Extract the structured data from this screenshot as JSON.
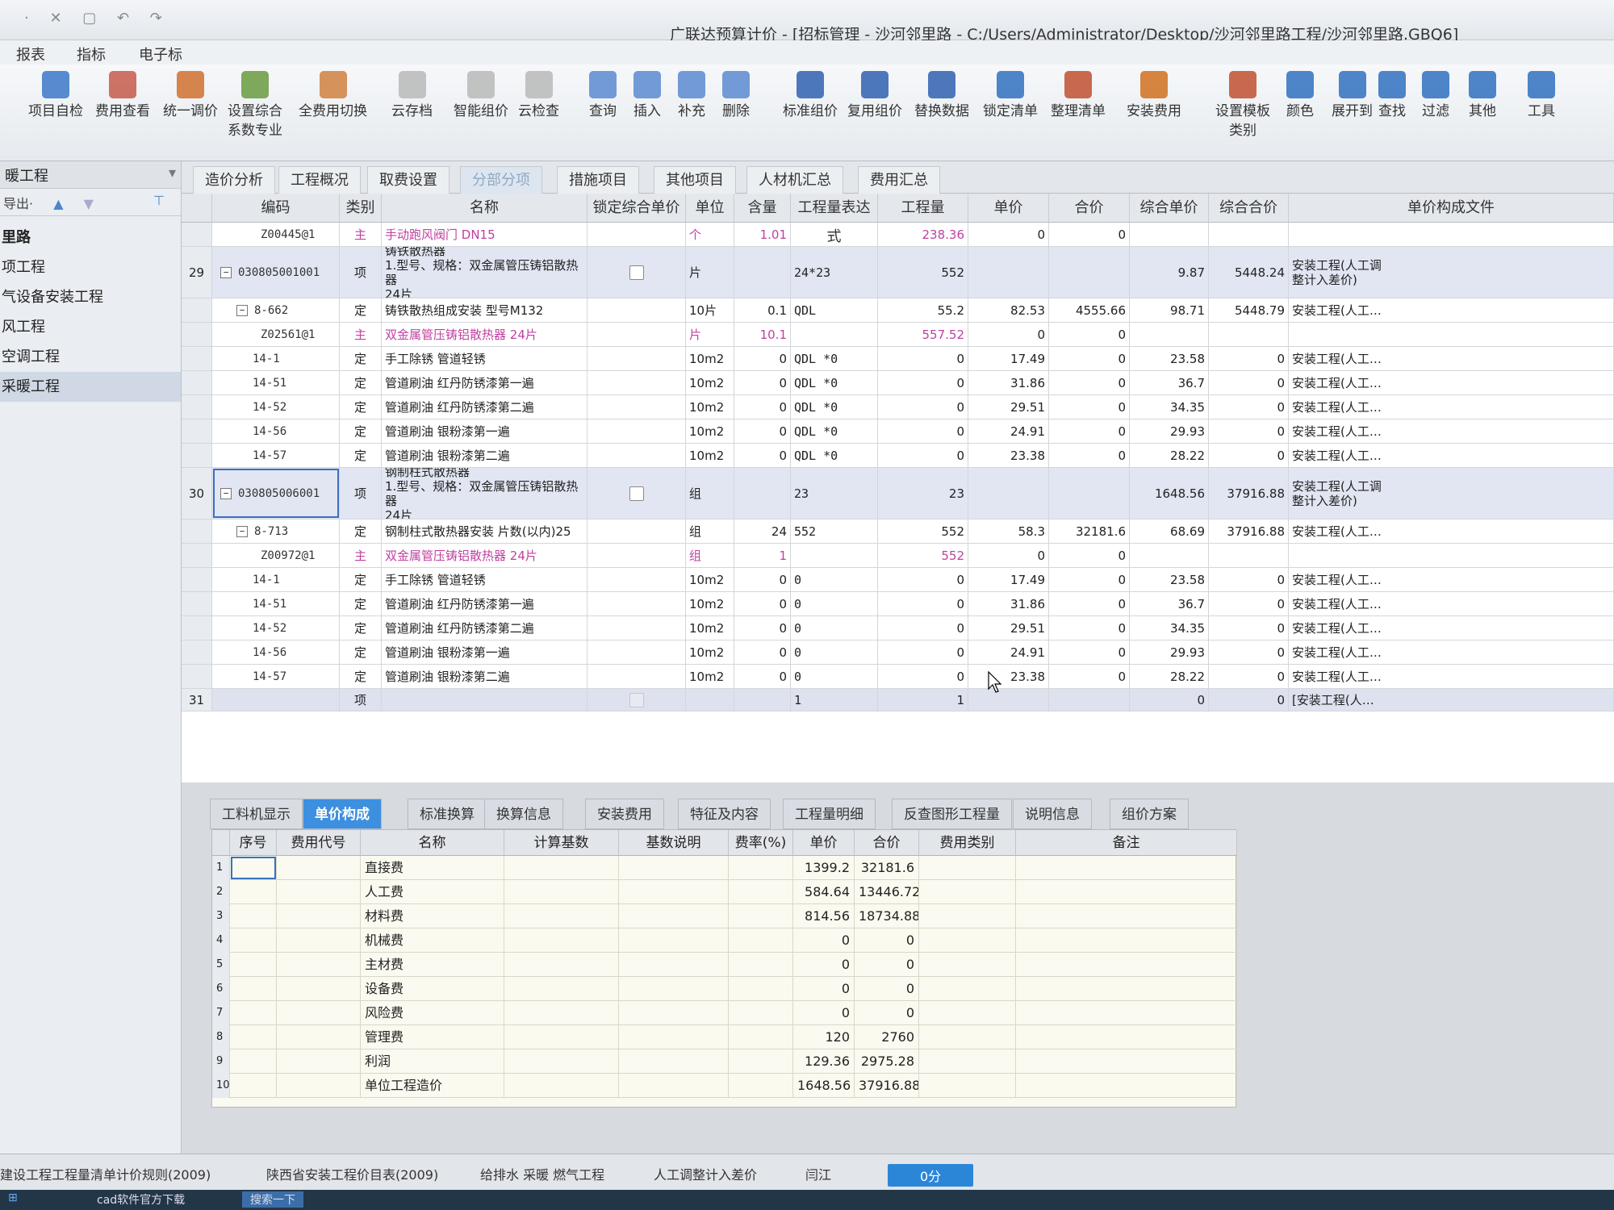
{
  "titlebar": {
    "quick_access": "· ✕ ▢ ↶ ↷",
    "title": "广联达预算计价 - [招标管理 - 沙河邻里路 - C:/Users/Administrator/Desktop/沙河邻里路工程/沙河邻里路.GBQ6]"
  },
  "menubar": [
    "报表",
    "指标",
    "电子标"
  ],
  "ribbon": [
    {
      "label": "项目自检",
      "icon": "check-icon",
      "color": "#3b78c8"
    },
    {
      "label": "费用查看",
      "icon": "view-cost-icon",
      "color": "#c65b4a"
    },
    {
      "label": "统一调价",
      "icon": "adjust-price-icon",
      "color": "#d07030"
    },
    {
      "label": "设置综合\n系数专业",
      "icon": "coefficient-icon",
      "color": "#6a9a40"
    },
    {
      "label": "全费用切换",
      "icon": "switch-icon",
      "color": "#d08040"
    },
    {
      "label": "云存档",
      "icon": "cloud-save-icon",
      "color": "#b8b8b8"
    },
    {
      "label": "智能组价",
      "icon": "smart-price-icon",
      "color": "#b8b8b8"
    },
    {
      "label": "云检查",
      "icon": "cloud-check-icon",
      "color": "#b8b8b8"
    },
    {
      "label": "查询",
      "icon": "query-icon",
      "color": "#5a8ad0"
    },
    {
      "label": "插入",
      "icon": "insert-icon",
      "color": "#5a8ad0"
    },
    {
      "label": "补充",
      "icon": "supplement-icon",
      "color": "#5a8ad0"
    },
    {
      "label": "删除",
      "icon": "delete-icon",
      "color": "#5a8ad0"
    },
    {
      "label": "标准组价",
      "icon": "standard-price-icon",
      "color": "#3060b0"
    },
    {
      "label": "复用组价",
      "icon": "reuse-price-icon",
      "color": "#3060b0"
    },
    {
      "label": "替换数据",
      "icon": "replace-data-icon",
      "color": "#3060b0"
    },
    {
      "label": "锁定清单",
      "icon": "lock-icon",
      "color": "#3070c0"
    },
    {
      "label": "整理清单",
      "icon": "organize-list-icon",
      "color": "#c05030"
    },
    {
      "label": "安装费用",
      "icon": "install-cost-icon",
      "color": "#d07020"
    },
    {
      "label": "设置模板\n类别",
      "icon": "template-icon",
      "color": "#c05030"
    },
    {
      "label": "颜色",
      "icon": "color-icon",
      "color": "#3070c0"
    },
    {
      "label": "展开到",
      "icon": "expand-icon",
      "color": "#3070c0"
    },
    {
      "label": "查找",
      "icon": "find-icon",
      "color": "#3070c0"
    },
    {
      "label": "过滤",
      "icon": "filter-icon",
      "color": "#3070c0"
    },
    {
      "label": "其他",
      "icon": "other-icon",
      "color": "#3070c0"
    },
    {
      "label": "工具",
      "icon": "tools-icon",
      "color": "#3070c0"
    }
  ],
  "left_panel": {
    "header": "暖工程",
    "toolbar": "导出·",
    "tree": [
      {
        "label": "里路",
        "bold": true,
        "selected": false
      },
      {
        "label": "项工程",
        "bold": false,
        "selected": false
      },
      {
        "label": "气设备安装工程",
        "bold": false,
        "selected": false
      },
      {
        "label": "风工程",
        "bold": false,
        "selected": false
      },
      {
        "label": "空调工程",
        "bold": false,
        "selected": false
      },
      {
        "label": "采暖工程",
        "bold": false,
        "selected": true
      }
    ]
  },
  "tabs": [
    {
      "label": "造价分析",
      "active": false
    },
    {
      "label": "工程概况",
      "active": false
    },
    {
      "label": "取费设置",
      "active": false
    },
    {
      "label": "分部分项",
      "active": true
    },
    {
      "label": "措施项目",
      "active": false
    },
    {
      "label": "其他项目",
      "active": false
    },
    {
      "label": "人材机汇总",
      "active": false
    },
    {
      "label": "费用汇总",
      "active": false
    }
  ],
  "grid": {
    "columns": [
      "编码",
      "类别",
      "名称",
      "锁定综合单价",
      "单位",
      "含量",
      "工程量表达式",
      "工程量",
      "单价",
      "合价",
      "综合单价",
      "综合合价",
      "单价构成文件"
    ],
    "rows": [
      {
        "num": "",
        "code": "Z00445@1",
        "type": "主",
        "name": "手动跑风阀门  DN15",
        "lock": "",
        "unit": "个",
        "qty_ratio": "1.01",
        "expr": "",
        "qty": "238.36",
        "price": "0",
        "total": "0",
        "comp_price": "",
        "comp_total": "",
        "file": "",
        "kind": "main"
      },
      {
        "num": "29",
        "code": "030805001001",
        "type": "项",
        "name": "铸铁散热器\n1.型号、规格：双金属管压铸铝散热器\n24片",
        "lock": "checkbox",
        "unit": "片",
        "qty_ratio": "",
        "expr": "24*23",
        "qty": "552",
        "price": "",
        "total": "",
        "comp_price": "9.87",
        "comp_total": "5448.24",
        "file": "安装工程(人工调\n整计入差价)",
        "kind": "item"
      },
      {
        "num": "",
        "code": "8-662",
        "type": "定",
        "name": "铸铁散热组成安装 型号M132",
        "lock": "",
        "unit": "10片",
        "qty_ratio": "0.1",
        "expr": "QDL",
        "qty": "55.2",
        "price": "82.53",
        "total": "4555.66",
        "comp_price": "98.71",
        "comp_total": "5448.79",
        "file": "安装工程(人工…",
        "kind": "quota"
      },
      {
        "num": "",
        "code": "Z02561@1",
        "type": "主",
        "name": "双金属管压铸铝散热器  24片",
        "lock": "",
        "unit": "片",
        "qty_ratio": "10.1",
        "expr": "",
        "qty": "557.52",
        "price": "0",
        "total": "0",
        "comp_price": "",
        "comp_total": "",
        "file": "",
        "kind": "main"
      },
      {
        "num": "",
        "code": "14-1",
        "type": "定",
        "name": "手工除锈 管道轻锈",
        "lock": "",
        "unit": "10m2",
        "qty_ratio": "0",
        "expr": "QDL *0",
        "qty": "0",
        "price": "17.49",
        "total": "0",
        "comp_price": "23.58",
        "comp_total": "0",
        "file": "安装工程(人工…",
        "kind": "quota"
      },
      {
        "num": "",
        "code": "14-51",
        "type": "定",
        "name": "管道刷油 红丹防锈漆第一遍",
        "lock": "",
        "unit": "10m2",
        "qty_ratio": "0",
        "expr": "QDL *0",
        "qty": "0",
        "price": "31.86",
        "total": "0",
        "comp_price": "36.7",
        "comp_total": "0",
        "file": "安装工程(人工…",
        "kind": "quota"
      },
      {
        "num": "",
        "code": "14-52",
        "type": "定",
        "name": "管道刷油 红丹防锈漆第二遍",
        "lock": "",
        "unit": "10m2",
        "qty_ratio": "0",
        "expr": "QDL *0",
        "qty": "0",
        "price": "29.51",
        "total": "0",
        "comp_price": "34.35",
        "comp_total": "0",
        "file": "安装工程(人工…",
        "kind": "quota"
      },
      {
        "num": "",
        "code": "14-56",
        "type": "定",
        "name": "管道刷油 银粉漆第一遍",
        "lock": "",
        "unit": "10m2",
        "qty_ratio": "0",
        "expr": "QDL *0",
        "qty": "0",
        "price": "24.91",
        "total": "0",
        "comp_price": "29.93",
        "comp_total": "0",
        "file": "安装工程(人工…",
        "kind": "quota"
      },
      {
        "num": "",
        "code": "14-57",
        "type": "定",
        "name": "管道刷油 银粉漆第二遍",
        "lock": "",
        "unit": "10m2",
        "qty_ratio": "0",
        "expr": "QDL *0",
        "qty": "0",
        "price": "23.38",
        "total": "0",
        "comp_price": "28.22",
        "comp_total": "0",
        "file": "安装工程(人工…",
        "kind": "quota"
      },
      {
        "num": "30",
        "code": "030805006001",
        "type": "项",
        "name": "钢制柱式散热器\n1.型号、规格：双金属管压铸铝散热器\n24片",
        "lock": "checkbox",
        "unit": "组",
        "qty_ratio": "",
        "expr": "23",
        "qty": "23",
        "price": "",
        "total": "",
        "comp_price": "1648.56",
        "comp_total": "37916.88",
        "file": "安装工程(人工调\n整计入差价)",
        "kind": "item"
      },
      {
        "num": "",
        "code": "8-713",
        "type": "定",
        "name": "钢制柱式散热器安装 片数(以内)25",
        "lock": "",
        "unit": "组",
        "qty_ratio": "24",
        "expr": "552",
        "qty": "552",
        "price": "58.3",
        "total": "32181.6",
        "comp_price": "68.69",
        "comp_total": "37916.88",
        "file": "安装工程(人工…",
        "kind": "quota"
      },
      {
        "num": "",
        "code": "Z00972@1",
        "type": "主",
        "name": "双金属管压铸铝散热器  24片",
        "lock": "",
        "unit": "组",
        "qty_ratio": "1",
        "expr": "",
        "qty": "552",
        "price": "0",
        "total": "0",
        "comp_price": "",
        "comp_total": "",
        "file": "",
        "kind": "main"
      },
      {
        "num": "",
        "code": "14-1",
        "type": "定",
        "name": "手工除锈 管道轻锈",
        "lock": "",
        "unit": "10m2",
        "qty_ratio": "0",
        "expr": "0",
        "qty": "0",
        "price": "17.49",
        "total": "0",
        "comp_price": "23.58",
        "comp_total": "0",
        "file": "安装工程(人工…",
        "kind": "quota"
      },
      {
        "num": "",
        "code": "14-51",
        "type": "定",
        "name": "管道刷油 红丹防锈漆第一遍",
        "lock": "",
        "unit": "10m2",
        "qty_ratio": "0",
        "expr": "0",
        "qty": "0",
        "price": "31.86",
        "total": "0",
        "comp_price": "36.7",
        "comp_total": "0",
        "file": "安装工程(人工…",
        "kind": "quota"
      },
      {
        "num": "",
        "code": "14-52",
        "type": "定",
        "name": "管道刷油 红丹防锈漆第二遍",
        "lock": "",
        "unit": "10m2",
        "qty_ratio": "0",
        "expr": "0",
        "qty": "0",
        "price": "29.51",
        "total": "0",
        "comp_price": "34.35",
        "comp_total": "0",
        "file": "安装工程(人工…",
        "kind": "quota"
      },
      {
        "num": "",
        "code": "14-56",
        "type": "定",
        "name": "管道刷油 银粉漆第一遍",
        "lock": "",
        "unit": "10m2",
        "qty_ratio": "0",
        "expr": "0",
        "qty": "0",
        "price": "24.91",
        "total": "0",
        "comp_price": "29.93",
        "comp_total": "0",
        "file": "安装工程(人工…",
        "kind": "quota"
      },
      {
        "num": "",
        "code": "14-57",
        "type": "定",
        "name": "管道刷油 银粉漆第二遍",
        "lock": "",
        "unit": "10m2",
        "qty_ratio": "0",
        "expr": "0",
        "qty": "0",
        "price": "23.38",
        "total": "0",
        "comp_price": "28.22",
        "comp_total": "0",
        "file": "安装工程(人工…",
        "kind": "quota"
      },
      {
        "num": "31",
        "code": "",
        "type": "项",
        "name": "",
        "lock": "checkbox-disabled",
        "unit": "",
        "qty_ratio": "",
        "expr": "1",
        "qty": "1",
        "price": "",
        "total": "",
        "comp_price": "0",
        "comp_total": "0",
        "file": "[安装工程(人…",
        "kind": "last"
      }
    ]
  },
  "bottom_tabs": [
    {
      "label": "工料机显示",
      "active": false
    },
    {
      "label": "单价构成",
      "active": true
    },
    {
      "label": "标准换算",
      "active": false
    },
    {
      "label": "换算信息",
      "active": false
    },
    {
      "label": "安装费用",
      "active": false
    },
    {
      "label": "特征及内容",
      "active": false
    },
    {
      "label": "工程量明细",
      "active": false
    },
    {
      "label": "反查图形工程量",
      "active": false
    },
    {
      "label": "说明信息",
      "active": false
    },
    {
      "label": "组价方案",
      "active": false
    }
  ],
  "subgrid": {
    "columns": [
      "序号",
      "费用代号",
      "名称",
      "计算基数",
      "基数说明",
      "费率(%)",
      "单价",
      "合价",
      "费用类别",
      "备注"
    ],
    "rows": [
      {
        "n": "1",
        "name": "直接费",
        "price": "1399.2",
        "total": "32181.6"
      },
      {
        "n": "2",
        "name": "人工费",
        "price": "584.64",
        "total": "13446.72"
      },
      {
        "n": "3",
        "name": "材料费",
        "price": "814.56",
        "total": "18734.88"
      },
      {
        "n": "4",
        "name": "机械费",
        "price": "0",
        "total": "0"
      },
      {
        "n": "5",
        "name": "主材费",
        "price": "0",
        "total": "0"
      },
      {
        "n": "6",
        "name": "设备费",
        "price": "0",
        "total": "0"
      },
      {
        "n": "7",
        "name": "风险费",
        "price": "0",
        "total": "0"
      },
      {
        "n": "8",
        "name": "管理费",
        "price": "120",
        "total": "2760"
      },
      {
        "n": "9",
        "name": "利润",
        "price": "129.36",
        "total": "2975.28"
      },
      {
        "n": "10",
        "name": "单位工程造价",
        "price": "1648.56",
        "total": "37916.88"
      }
    ]
  },
  "statusbar": [
    "建设工程工程量清单计价规则(2009)",
    "陕西省安装工程价目表(2009)",
    "给排水 采暖 燃气工程",
    "人工调整计入差价",
    "闫江"
  ],
  "status_button": "0分",
  "taskbar": [
    "cad软件官方下载",
    "搜索一下"
  ]
}
